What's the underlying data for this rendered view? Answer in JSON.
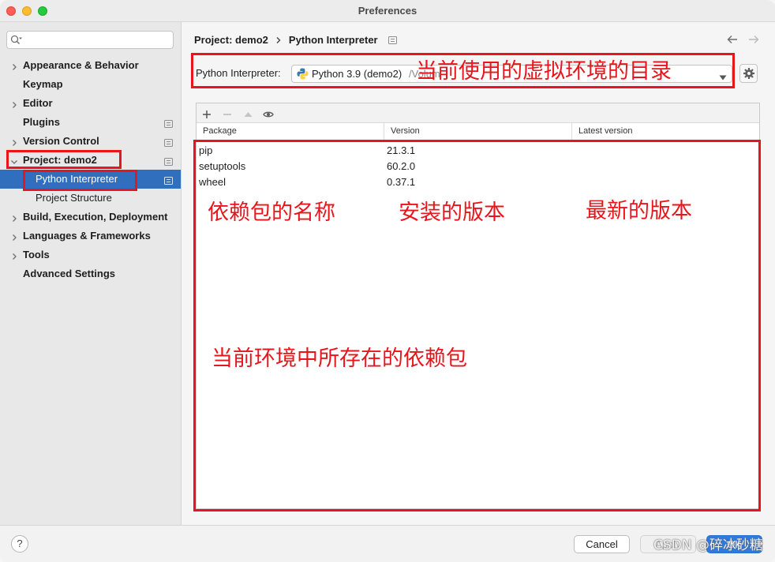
{
  "window": {
    "title": "Preferences"
  },
  "colors": {
    "accent": "#2f6fbe",
    "annotation": "#e8161c",
    "ok_button": "#2e7ae0"
  },
  "sidebar": {
    "items": [
      {
        "label": "Appearance & Behavior",
        "chevron": "chevron-right-icon"
      },
      {
        "label": "Keymap"
      },
      {
        "label": "Editor",
        "chevron": "chevron-right-icon"
      },
      {
        "label": "Plugins",
        "icon": "settings-scope-icon"
      },
      {
        "label": "Version Control",
        "chevron": "chevron-right-icon",
        "icon": "settings-scope-icon"
      },
      {
        "label": "Project: demo2",
        "chevron": "chevron-down-icon",
        "icon": "settings-scope-icon"
      },
      {
        "label": "Python Interpreter",
        "selected": true,
        "icon": "settings-scope-icon"
      },
      {
        "label": "Project Structure"
      },
      {
        "label": "Build, Execution, Deployment",
        "chevron": "chevron-right-icon"
      },
      {
        "label": "Languages & Frameworks",
        "chevron": "chevron-right-icon"
      },
      {
        "label": "Tools",
        "chevron": "chevron-right-icon"
      },
      {
        "label": "Advanced Settings"
      }
    ]
  },
  "breadcrumb": {
    "parent": "Project: demo2",
    "current": "Python Interpreter"
  },
  "interpreter": {
    "label": "Python Interpreter:",
    "selected": "Python 3.9 (demo2)",
    "path": "/Volum"
  },
  "packages": {
    "toolbar": [
      "add-icon",
      "remove-icon",
      "upgrade-icon",
      "eye-icon"
    ],
    "columns": [
      "Package",
      "Version",
      "Latest version"
    ],
    "rows": [
      {
        "name": "pip",
        "version": "21.3.1"
      },
      {
        "name": "setuptools",
        "version": "60.2.0"
      },
      {
        "name": "wheel",
        "version": "0.37.1"
      }
    ]
  },
  "annotations": {
    "interpreter_dir": "当前使用的虚拟环境的目录",
    "package_name": "依赖包的名称",
    "installed_version": "安装的版本",
    "latest_version": "最新的版本",
    "installed_packages": "当前环境中所存在的依赖包"
  },
  "footer": {
    "help": "?",
    "cancel": "Cancel",
    "apply": "Apply",
    "ok": "OK"
  },
  "watermark": "CSDN @碎冰砂糖"
}
